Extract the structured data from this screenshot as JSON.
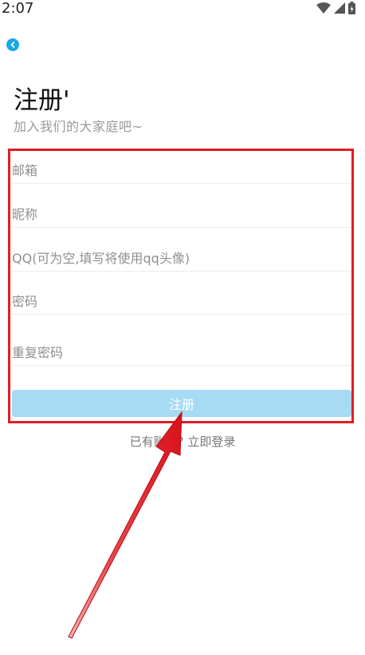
{
  "status_bar": {
    "time": "2:07",
    "icons": [
      "wifi-icon",
      "signal-icon",
      "battery-icon"
    ]
  },
  "header": {
    "back_icon": "chevron-left-icon",
    "title": "注册'",
    "subtitle": "加入我们的大家庭吧~"
  },
  "form": {
    "email_placeholder": "邮箱",
    "nickname_placeholder": "昵称",
    "qq_placeholder": "QQ(可为空,填写将使用qq头像)",
    "password_placeholder": "密码",
    "confirm_password_placeholder": "重复密码",
    "submit_label": "注册"
  },
  "footer": {
    "login_link": "已有账户? 立即登录"
  },
  "colors": {
    "accent": "#1aa7e8",
    "button_bg": "#a7daf3",
    "annotation_red": "#e11d24"
  }
}
